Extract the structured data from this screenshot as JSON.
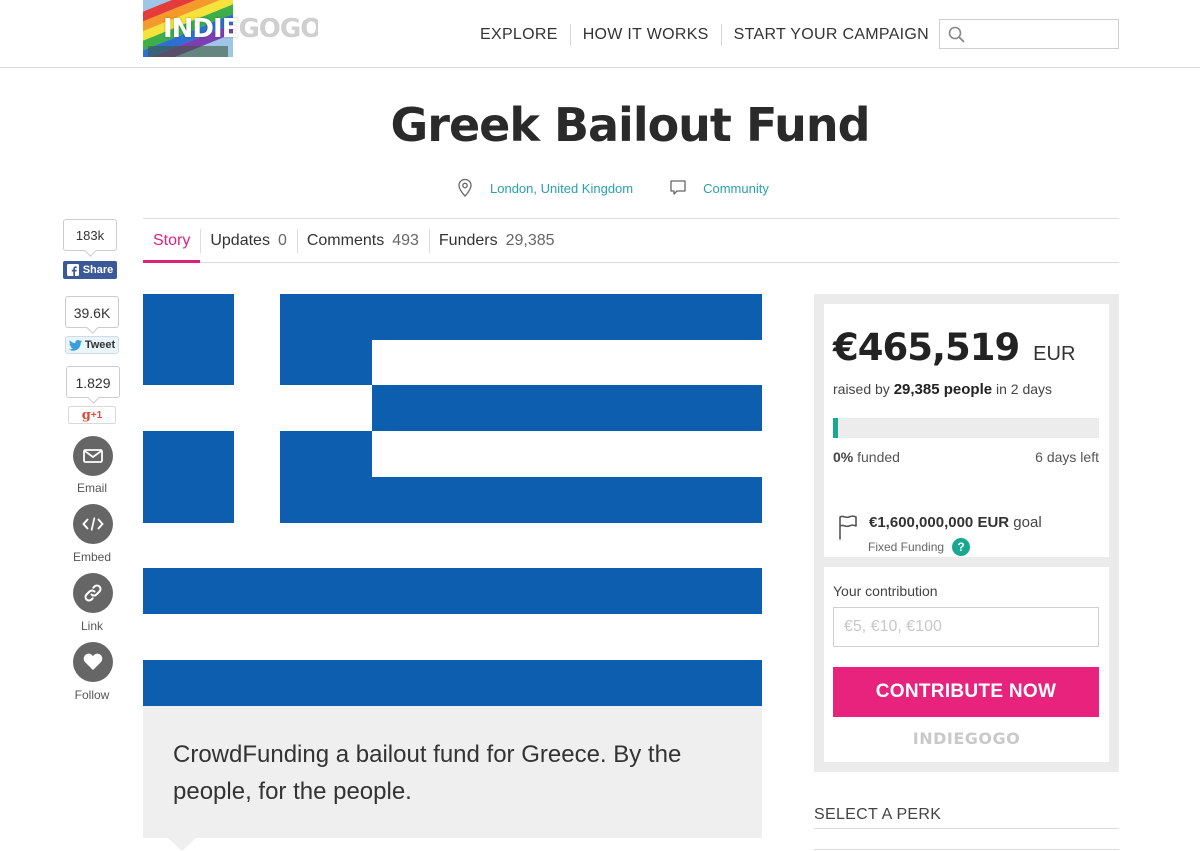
{
  "header": {
    "logo_text_white": "INDIE",
    "logo_text_grey": "GOGO",
    "nav": [
      "EXPLORE",
      "HOW IT WORKS",
      "START YOUR CAMPAIGN"
    ],
    "search_placeholder": ""
  },
  "campaign": {
    "title": "Greek Bailout Fund",
    "location": "London, United Kingdom",
    "category": "Community"
  },
  "tabs": [
    {
      "label": "Story",
      "count": ""
    },
    {
      "label": "Updates",
      "count": "0"
    },
    {
      "label": "Comments",
      "count": "493"
    },
    {
      "label": "Funders",
      "count": "29,385"
    }
  ],
  "social": {
    "facebook_count": "183k",
    "facebook_label": "Share",
    "twitter_count": "39.6K",
    "twitter_label": "Tweet",
    "gplus_count": "1.829",
    "gplus_label": "+1",
    "gplus_g": "g",
    "actions": [
      "Email",
      "Embed",
      "Link",
      "Follow"
    ]
  },
  "story": {
    "blurb": "CrowdFunding a bailout fund for Greece. By the people, for the people."
  },
  "funding": {
    "amount": "€465,519",
    "currency": "EUR",
    "raised_prefix": "raised by",
    "people": "29,385 people",
    "raised_suffix": "in 2 days",
    "progress_fraction": 0.02,
    "percent_value": "0%",
    "percent_word": "funded",
    "days_left": "6 days left",
    "goal_amount": "€1,600,000,000",
    "goal_currency": "EUR",
    "goal_word": "goal",
    "funding_type": "Fixed Funding",
    "help_symbol": "?"
  },
  "contribution": {
    "label": "Your contribution",
    "placeholder": "€5, €10, €100",
    "button": "CONTRIBUTE NOW",
    "brand": "INDIEGOGO"
  },
  "perks": {
    "title": "SELECT A PERK"
  },
  "colors": {
    "accent_pink": "#e8237e",
    "teal": "#1ba890",
    "link": "#2a9fb0",
    "greek_blue": "#0d5eaf"
  }
}
